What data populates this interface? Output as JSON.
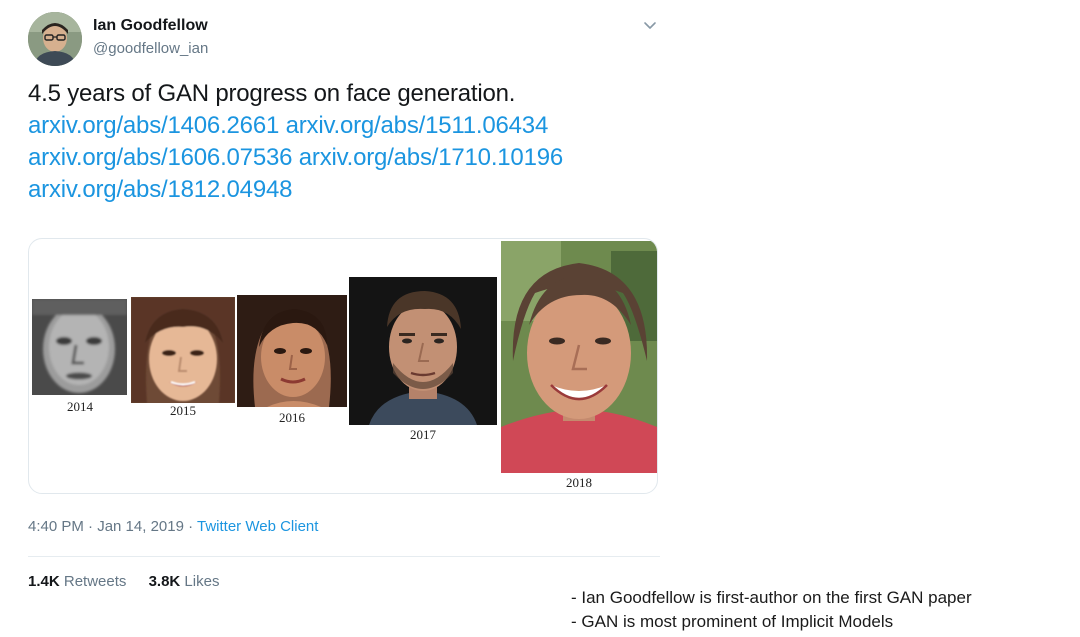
{
  "tweet": {
    "author": {
      "display_name": "Ian Goodfellow",
      "handle": "@goodfellow_ian"
    },
    "headline": "4.5 years of GAN progress on face generation.",
    "links": [
      "arxiv.org/abs/1406.2661",
      "arxiv.org/abs/1511.06434",
      "arxiv.org/abs/1606.07536",
      "arxiv.org/abs/1710.10196",
      "arxiv.org/abs/1812.04948"
    ],
    "media": {
      "years": [
        "2014",
        "2015",
        "2016",
        "2017",
        "2018"
      ]
    },
    "timestamp": "4:40 PM · Jan 14, 2019 · ",
    "client": "Twitter Web Client",
    "stats": {
      "retweets_count": "1.4K",
      "retweets_label": "Retweets",
      "likes_count": "3.8K",
      "likes_label": "Likes"
    }
  },
  "notes": [
    "- Ian Goodfellow is first-author on the first GAN paper",
    "- GAN is most prominent of Implicit Models"
  ],
  "colors": {
    "link": "#1b95e0",
    "secondary_text": "#657786",
    "primary_text": "#14171a",
    "card_border": "#e1e8ed"
  },
  "icons": {
    "more": "chevron-down-icon",
    "avatar": "avatar-photo"
  }
}
